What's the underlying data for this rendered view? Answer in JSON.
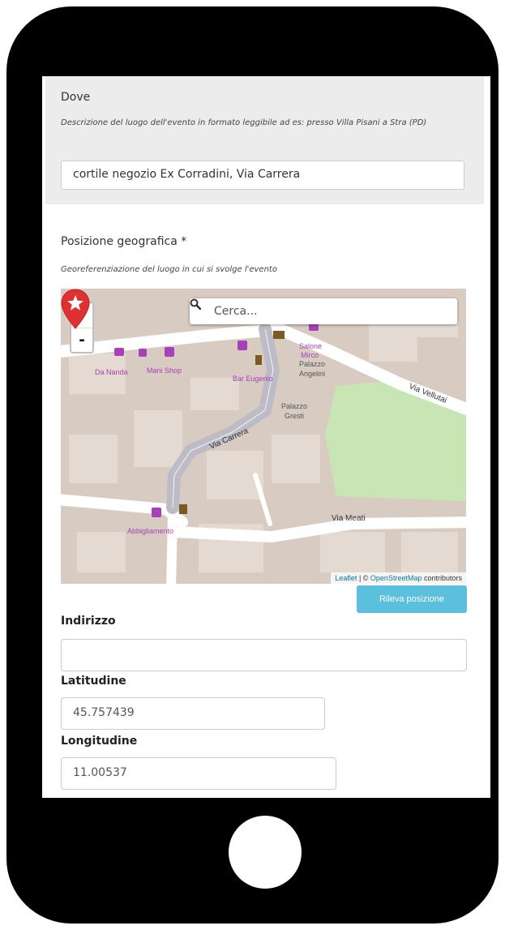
{
  "dove": {
    "title": "Dove",
    "description": "Descrizione del luogo dell'evento in formato leggibile ad es: presso Villa Pisani a Stra (PD)",
    "value": "cortile negozio Ex Corradini, Via Carrera"
  },
  "posizione": {
    "title": "Posizione geografica *",
    "description": "Georeferenziazione del luogo in cui si svolge l'evento"
  },
  "map": {
    "zoom_in": "+",
    "zoom_out": "-",
    "search_placeholder": "Cerca...",
    "labels": {
      "da_nanda": "Da Nanda",
      "mani_shop": "Mani Shop",
      "bar": "Bar Eugenio",
      "salone": "Salone",
      "salone_2": "Mirco",
      "palazzo_angelini": "Palazzo",
      "palazzo_angelini_2": "Angelini",
      "palazzo_gresti": "Palazzo",
      "palazzo_gresti_2": "Gresti",
      "via_carrera": "Via Carrera",
      "via_vellutai": "Via Vellutai",
      "via_meati": "Via Meati",
      "abbigliamento": "Abbigliamento"
    },
    "attribution_leaflet": "Leaflet",
    "attribution_sep": " | © ",
    "attribution_osm": "OpenStreetMap",
    "attribution_rest": " contributors",
    "marker_color": "#e03131"
  },
  "rileva_button": "Rileva posizione",
  "indirizzo": {
    "label": "Indirizzo",
    "value": ""
  },
  "latitudine": {
    "label": "Latitudine",
    "value": "45.757439"
  },
  "longitudine": {
    "label": "Longitudine",
    "value": "11.00537"
  },
  "colors": {
    "accent": "#5bc0de",
    "park": "#c8e6b3",
    "building": "#d4c7bd"
  }
}
